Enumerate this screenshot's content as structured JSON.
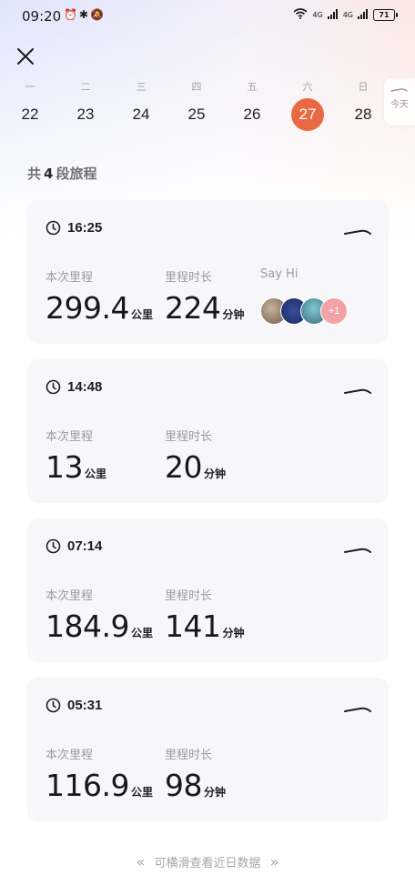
{
  "status_bar": {
    "time": "09:20",
    "left_icons": [
      "alarm-icon",
      "bluetooth-icon",
      "mute-icon"
    ],
    "network_1": "4G",
    "network_2": "4G",
    "battery": "71"
  },
  "calendar": {
    "days": [
      {
        "label": "一",
        "num": "22",
        "selected": false
      },
      {
        "label": "二",
        "num": "23",
        "selected": false
      },
      {
        "label": "三",
        "num": "24",
        "selected": false
      },
      {
        "label": "四",
        "num": "25",
        "selected": false
      },
      {
        "label": "五",
        "num": "26",
        "selected": false
      },
      {
        "label": "六",
        "num": "27",
        "selected": true
      },
      {
        "label": "日",
        "num": "28",
        "selected": false
      }
    ],
    "today_label": "今天",
    "accent": "#e96a42"
  },
  "summary": {
    "prefix": "共",
    "count": "4",
    "suffix": "段旅程"
  },
  "trips": [
    {
      "time": "16:25",
      "distance_label": "本次里程",
      "distance": "299.4",
      "distance_unit": "公里",
      "duration_label": "里程时长",
      "duration": "224",
      "duration_unit": "分钟",
      "sayhi_label": "Say Hi",
      "more_count": "+1"
    },
    {
      "time": "14:48",
      "distance_label": "本次里程",
      "distance": "13",
      "distance_unit": "公里",
      "duration_label": "里程时长",
      "duration": "20",
      "duration_unit": "分钟"
    },
    {
      "time": "07:14",
      "distance_label": "本次里程",
      "distance": "184.9",
      "distance_unit": "公里",
      "duration_label": "里程时长",
      "duration": "141",
      "duration_unit": "分钟"
    },
    {
      "time": "05:31",
      "distance_label": "本次里程",
      "distance": "116.9",
      "distance_unit": "公里",
      "duration_label": "里程时长",
      "duration": "98",
      "duration_unit": "分钟"
    }
  ],
  "footer": {
    "hint": "可横滑查看近日数据",
    "left_arrows": "«",
    "right_arrows": "»"
  }
}
